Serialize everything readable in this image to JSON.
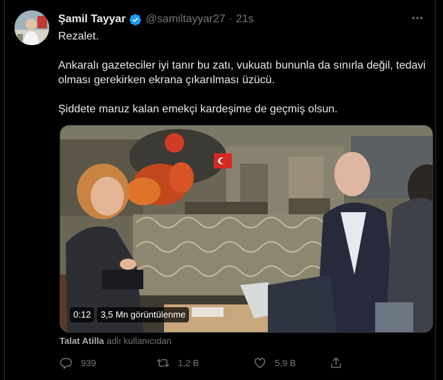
{
  "tweet": {
    "author_name": "Şamil Tayyar",
    "handle": "@samiltayyar27",
    "separator": "·",
    "time": "21s",
    "lines": [
      "Rezalet.",
      "Ankaralı gazeteciler iyi tanır bu zatı, vukuatı bununla da sınırla değil, tedavi olması gerekirken ekrana çıkarılması üzücü.",
      "Şiddete maruz kalan emekçi kardeşime de geçmiş olsun."
    ],
    "more_icon": "ellipsis-icon",
    "verified_icon": "verified-badge-icon"
  },
  "media": {
    "duration": "0:12",
    "views": "3,5 Mn görüntülenme"
  },
  "attribution": {
    "user": "Talat Atilla",
    "suffix": "adlı kullanıcıdan"
  },
  "actions": {
    "reply_count": "939",
    "retweet_count": "1,2 B",
    "like_count": "5,9 B",
    "icons": [
      "reply-icon",
      "retweet-icon",
      "like-icon",
      "share-icon"
    ]
  },
  "colors": {
    "background": "#000000",
    "text": "#e7e9ea",
    "muted": "#71767b",
    "verified": "#1d9bf0"
  }
}
